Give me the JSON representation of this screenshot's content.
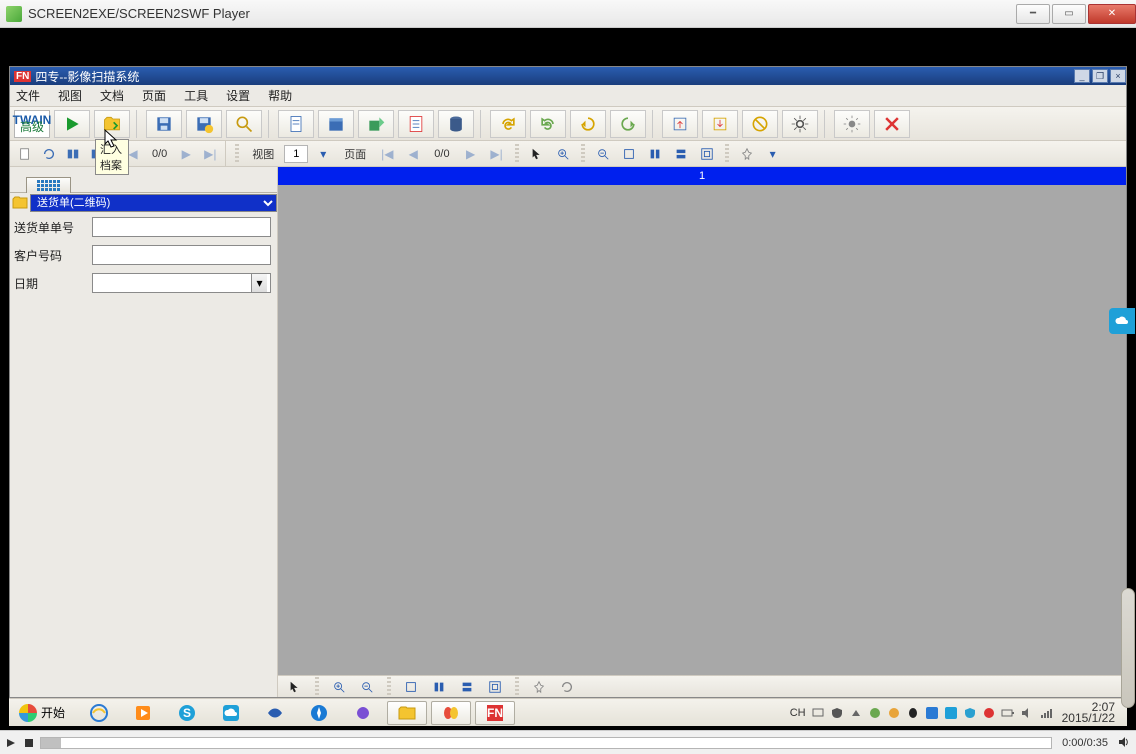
{
  "player": {
    "title": "SCREEN2EXE/SCREEN2SWF Player",
    "timecode": "0:00/0:35"
  },
  "app": {
    "badge": "FN",
    "title": "四专--影像扫描系统",
    "menu": [
      "文件",
      "视图",
      "文档",
      "页面",
      "工具",
      "设置",
      "帮助"
    ]
  },
  "toolbar1": {
    "twain_top": "TWAIN",
    "twain_sub": "高级",
    "tooltip": "汇入档案"
  },
  "toolbar2_left": {
    "counter": "0/0"
  },
  "toolbar2_right": {
    "view_label": "视图",
    "view_value": "1",
    "page_label": "页面",
    "page_counter": "0/0"
  },
  "left_pane": {
    "doc_type": "送货单(二维码)",
    "fields": [
      {
        "label": "送货单单号",
        "value": ""
      },
      {
        "label": "客户号码",
        "value": ""
      },
      {
        "label": "日期",
        "value": "",
        "type": "date"
      }
    ]
  },
  "viewer_tab": "1",
  "taskbar": {
    "start_label": "开始",
    "lang": "CH",
    "time": "2:07",
    "date": "2015/1/22"
  }
}
